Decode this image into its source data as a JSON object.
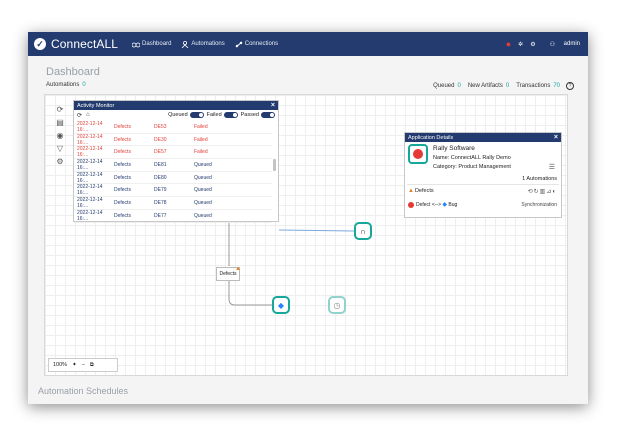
{
  "app": {
    "logo_text": "ConnectALL",
    "nav": [
      {
        "label": "Dashboard"
      },
      {
        "label": "Automations"
      },
      {
        "label": "Connections"
      }
    ],
    "user": "admin"
  },
  "page": {
    "title": "Dashboard",
    "automations_label": "Automations",
    "automations_count": "0",
    "queued_label": "Queued",
    "queued_count": "0",
    "artifacts_label": "New Artifacts",
    "artifacts_count": "0",
    "transactions_label": "Transactions",
    "transactions_count": "70",
    "schedules_title": "Automation Schedules"
  },
  "activity_monitor": {
    "title": "Activity Monitor",
    "filters": [
      "Queued",
      "Failed",
      "Passed"
    ],
    "rows": [
      {
        "time": "2022-12-14 16:...",
        "type": "Defects",
        "id": "DE53",
        "status": "Failed"
      },
      {
        "time": "2022-12-14 16:...",
        "type": "Defects",
        "id": "DE30",
        "status": "Failed"
      },
      {
        "time": "2022-12-14 16:...",
        "type": "Defects",
        "id": "DE57",
        "status": "Failed"
      },
      {
        "time": "2022-12-14 16:...",
        "type": "Defects",
        "id": "DE81",
        "status": "Queued"
      },
      {
        "time": "2022-12-14 16:...",
        "type": "Defects",
        "id": "DE80",
        "status": "Queued"
      },
      {
        "time": "2022-12-14 16:...",
        "type": "Defects",
        "id": "DE79",
        "status": "Queued"
      },
      {
        "time": "2022-12-14 16:...",
        "type": "Defects",
        "id": "DE78",
        "status": "Queued"
      },
      {
        "time": "2022-12-14 16:...",
        "type": "Defects",
        "id": "DE77",
        "status": "Queued"
      }
    ]
  },
  "app_details": {
    "title": "Application Details",
    "name": "Rally Software",
    "name_line": "Name: ConnectALL Rally Demo",
    "category_line": "Category: Product Management",
    "automations": "1 Automations",
    "defects": "Defects",
    "map_from": "Defect",
    "map_arrow": "<-->",
    "map_to": "Bug",
    "sync": "Synchronization"
  },
  "canvas": {
    "edge_label": "Defects",
    "zoom": "100%"
  },
  "colors": {
    "navy": "#233b6e",
    "teal": "#15a89a",
    "failed": "#e0413a"
  }
}
